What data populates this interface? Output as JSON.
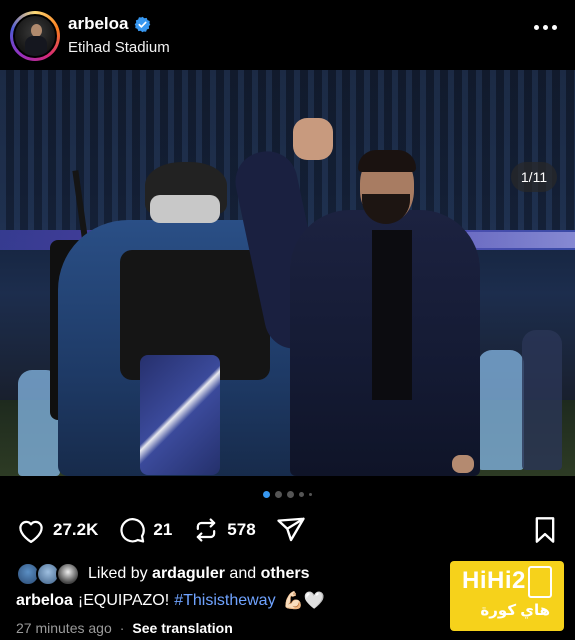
{
  "post": {
    "username": "arbeloa",
    "location": "Etihad Stadium",
    "verified": true
  },
  "media": {
    "counter": "1/11",
    "dots": {
      "total": 5,
      "active_index": 0
    }
  },
  "actions": {
    "likes_count": "27.2K",
    "comments_count": "21",
    "reposts_count": "578"
  },
  "liked_by": {
    "prefix": "Liked by",
    "user": "ardaguler",
    "connector": "and",
    "others": "others"
  },
  "caption": {
    "username": "arbeloa",
    "text": "¡EQUIPAZO!",
    "hashtag": "#Thisistheway",
    "emoji": "💪🏻🤍"
  },
  "meta": {
    "time": "27 minutes ago",
    "separator": "·",
    "translate": "See translation"
  },
  "watermark": {
    "latin": "HiHi2",
    "arabic": "هاي كورة"
  },
  "colors": {
    "verified": "#3797f0",
    "hashtag": "#6fa3ff",
    "active_dot": "#3797f0",
    "watermark_bg": "#f6d21b"
  }
}
